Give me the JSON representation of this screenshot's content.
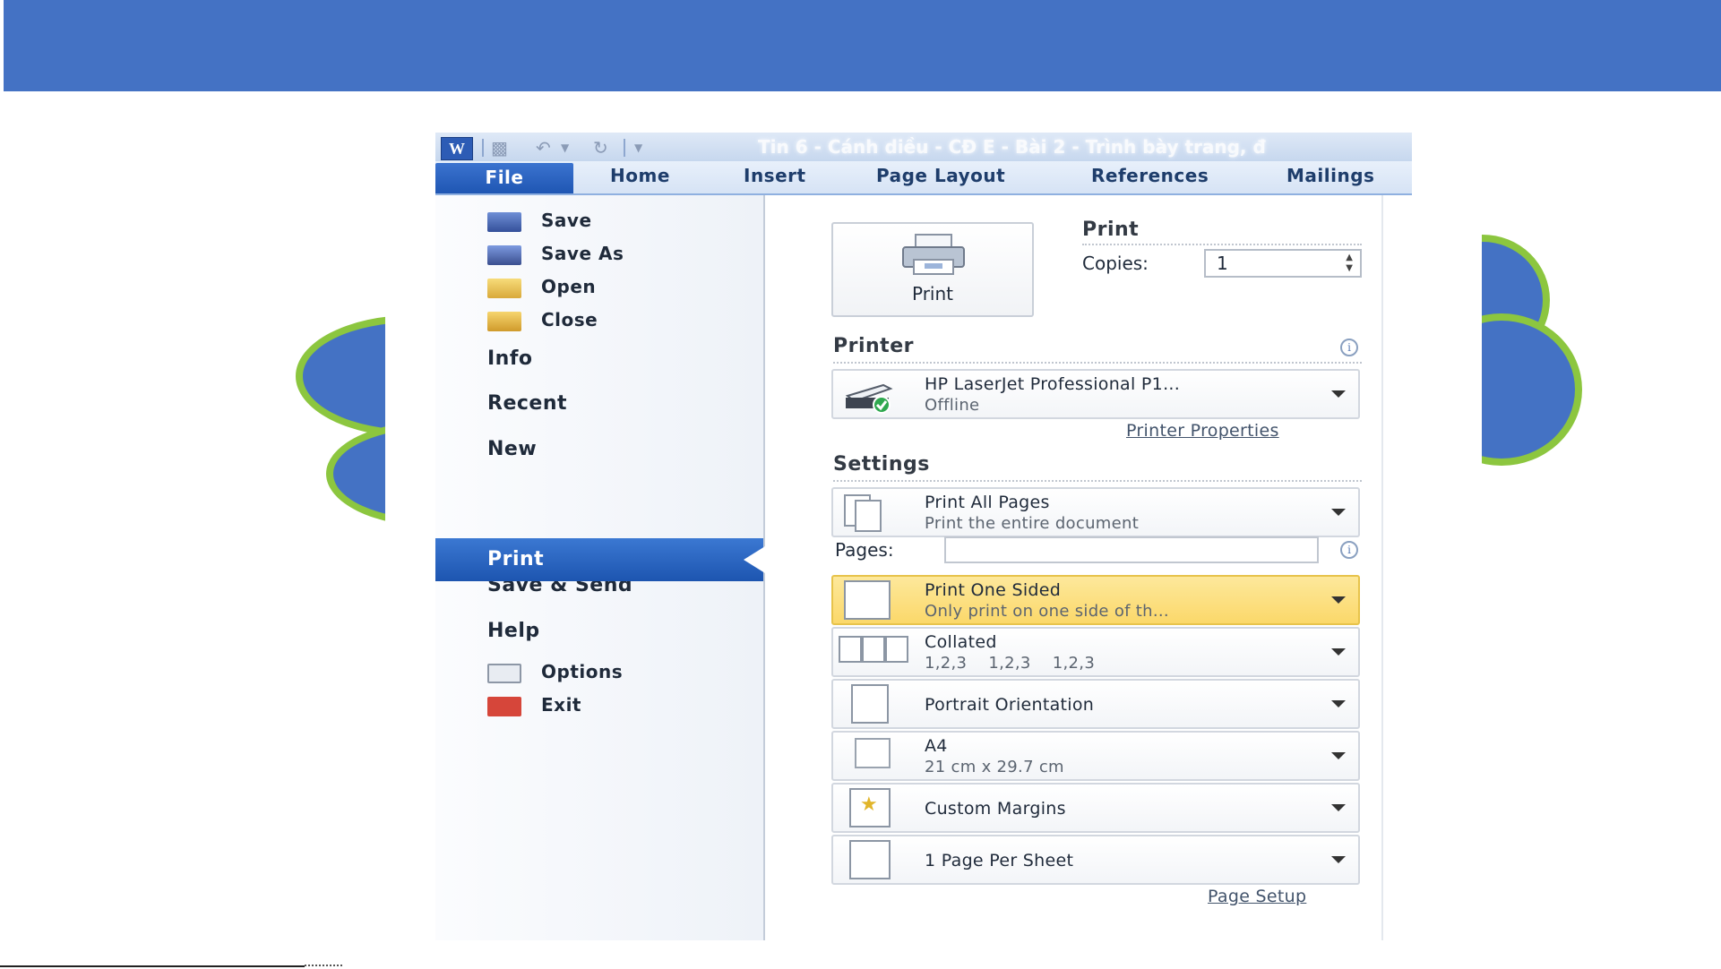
{
  "slide": {
    "colors": {
      "header": "#4472c4",
      "blob_fill": "#4472c4",
      "blob_border": "#8cc63f"
    }
  },
  "window": {
    "title": "Tin 6 - Cánh diều - CĐ E - Bài 2 - Trình bày trang, đ",
    "app_icon": "W",
    "ribbon_tabs": [
      "File",
      "Home",
      "Insert",
      "Page Layout",
      "References",
      "Mailings"
    ]
  },
  "nav": {
    "save": "Save",
    "save_as": "Save As",
    "open": "Open",
    "close": "Close",
    "info": "Info",
    "recent": "Recent",
    "new": "New",
    "print": "Print",
    "save_send": "Save & Send",
    "help": "Help",
    "options": "Options",
    "exit": "Exit"
  },
  "print": {
    "heading": "Print",
    "button_label": "Print",
    "copies_label": "Copies:",
    "copies_value": "1"
  },
  "printer": {
    "heading": "Printer",
    "name": "HP LaserJet Professional P1...",
    "status": "Offline",
    "properties_link": "Printer Properties"
  },
  "settings": {
    "heading": "Settings",
    "pages_label": "Pages:",
    "pages_value": "",
    "options": [
      {
        "title": "Print All Pages",
        "subtitle": "Print the entire document"
      },
      {
        "title": "Print One Sided",
        "subtitle": "Only print on one side of th..."
      },
      {
        "title": "Collated",
        "subtitle": "1,2,3    1,2,3    1,2,3"
      },
      {
        "title": "Portrait Orientation",
        "subtitle": ""
      },
      {
        "title": "A4",
        "subtitle": "21 cm x 29.7 cm"
      },
      {
        "title": "Custom Margins",
        "subtitle": ""
      },
      {
        "title": "1 Page Per Sheet",
        "subtitle": ""
      }
    ],
    "page_setup_link": "Page Setup"
  }
}
